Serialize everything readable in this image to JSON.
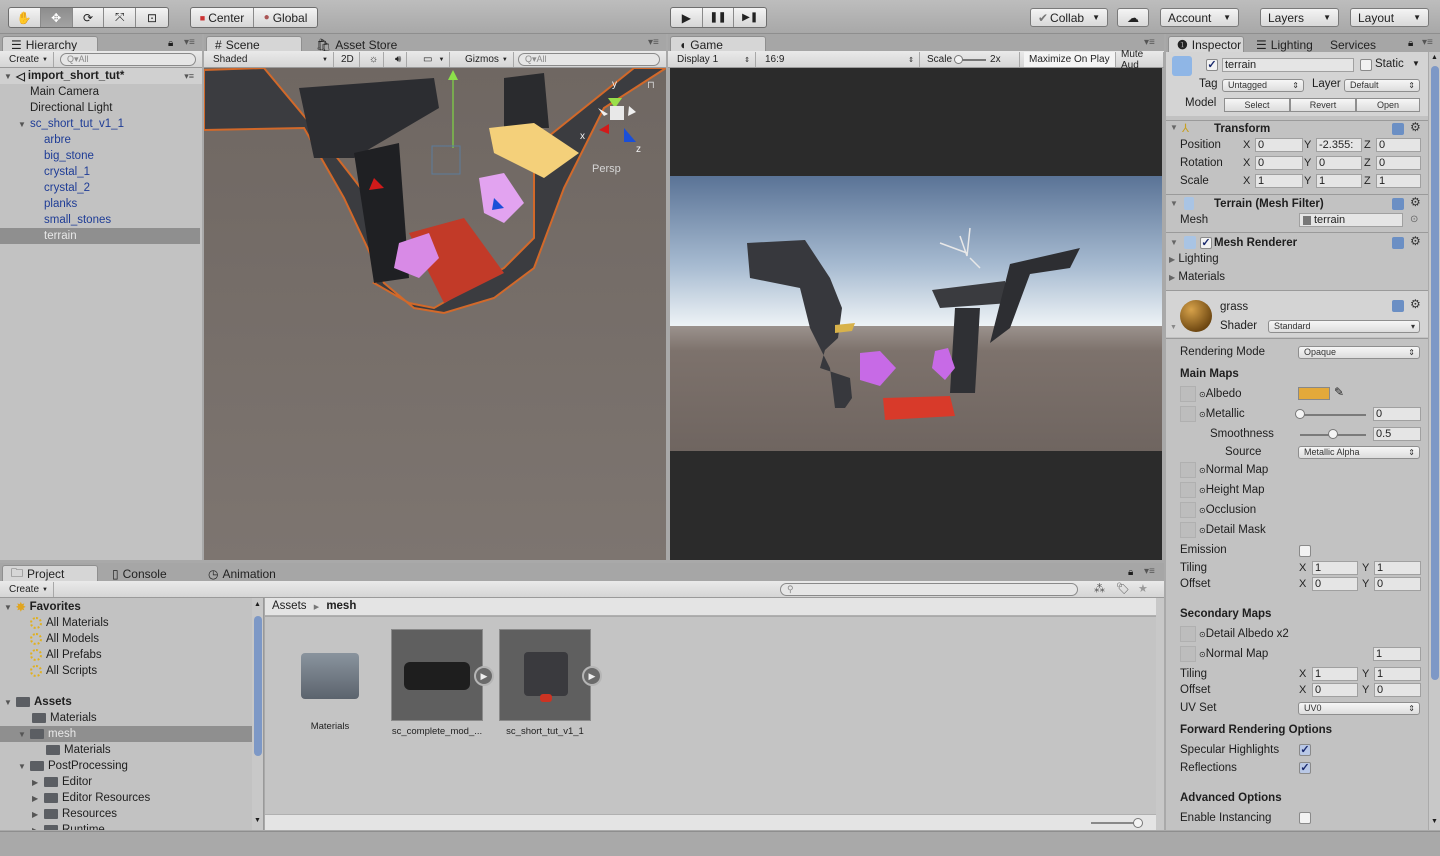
{
  "toolbar": {
    "transform_tools": [
      {
        "name": "hand-tool",
        "icon": "hand-icon",
        "glyph": "✋"
      },
      {
        "name": "move-tool",
        "icon": "move-icon",
        "glyph": "✥",
        "active": true
      },
      {
        "name": "rotate-tool",
        "icon": "rotate-icon",
        "glyph": "⟳"
      },
      {
        "name": "scale-tool",
        "icon": "scale-icon",
        "glyph": "⤧"
      },
      {
        "name": "rect-tool",
        "icon": "rect-icon",
        "glyph": "⊡"
      }
    ],
    "pivot_label": "Center",
    "space_label": "Global",
    "play": {
      "play_glyph": "▶",
      "pause_glyph": "❚❚",
      "step_glyph": "▶❚"
    },
    "collab_label": "Collab",
    "account_label": "Account",
    "layers_label": "Layers",
    "layout_label": "Layout"
  },
  "hierarchy": {
    "tab_label": "Hierarchy",
    "create_label": "Create",
    "search_placeholder": "Q▾All",
    "scene_name": "import_short_tut*",
    "items": [
      {
        "label": "Main Camera",
        "depth": 1,
        "prefab": false
      },
      {
        "label": "Directional Light",
        "depth": 1,
        "prefab": false
      },
      {
        "label": "sc_short_tut_v1_1",
        "depth": 1,
        "prefab": true,
        "expanded": true
      },
      {
        "label": "arbre",
        "depth": 2,
        "prefab": true
      },
      {
        "label": "big_stone",
        "depth": 2,
        "prefab": true
      },
      {
        "label": "crystal_1",
        "depth": 2,
        "prefab": true
      },
      {
        "label": "crystal_2",
        "depth": 2,
        "prefab": true
      },
      {
        "label": "planks",
        "depth": 2,
        "prefab": true
      },
      {
        "label": "small_stones",
        "depth": 2,
        "prefab": true
      },
      {
        "label": "terrain",
        "depth": 2,
        "prefab": true,
        "selected": true
      }
    ]
  },
  "scene": {
    "tab_label": "Scene",
    "asset_store_label": "Asset Store",
    "shading_mode": "Shaded",
    "mode_2d_label": "2D",
    "gizmos_label": "Gizmos",
    "search_placeholder": "Q▾All",
    "projection_label": "Persp",
    "axis_labels": {
      "x": "x",
      "y": "y",
      "z": "z"
    }
  },
  "game": {
    "tab_label": "Game",
    "display_label": "Display 1",
    "aspect_label": "16:9",
    "scale_label": "Scale",
    "scale_value": "2x",
    "maximize_label": "Maximize On Play",
    "mute_label": "Mute Aud"
  },
  "inspector": {
    "tabs": [
      "Inspector",
      "Lighting",
      "Services"
    ],
    "object_name": "terrain",
    "active": true,
    "static_label": "Static",
    "tag_label": "Tag",
    "tag_value": "Untagged",
    "layer_label": "Layer",
    "layer_value": "Default",
    "model_label": "Model",
    "model_buttons": [
      "Select",
      "Revert",
      "Open"
    ],
    "transform": {
      "title": "Transform",
      "rows": [
        {
          "label": "Position",
          "x": "0",
          "y": "-2.355:",
          "z": "0"
        },
        {
          "label": "Rotation",
          "x": "0",
          "y": "0",
          "z": "0"
        },
        {
          "label": "Scale",
          "x": "1",
          "y": "1",
          "z": "1"
        }
      ]
    },
    "mesh_filter": {
      "title": "Terrain (Mesh Filter)",
      "mesh_label": "Mesh",
      "mesh_value": "terrain"
    },
    "mesh_renderer": {
      "title": "Mesh Renderer",
      "enabled": true,
      "sections": [
        "Lighting",
        "Materials"
      ]
    },
    "material": {
      "name": "grass",
      "shader_label": "Shader",
      "shader_value": "Standard",
      "rendering_mode_label": "Rendering Mode",
      "rendering_mode_value": "Opaque",
      "main_maps_label": "Main Maps",
      "albedo_label": "Albedo",
      "albedo_color": "#e3a93a",
      "metallic_label": "Metallic",
      "metallic_value": "0",
      "metallic_fraction": 0.0,
      "smoothness_label": "Smoothness",
      "smoothness_value": "0.5",
      "smoothness_fraction": 0.5,
      "source_label": "Source",
      "source_value": "Metallic Alpha",
      "normal_map_label": "Normal Map",
      "height_map_label": "Height Map",
      "occlusion_label": "Occlusion",
      "detail_mask_label": "Detail Mask",
      "emission_label": "Emission",
      "emission_on": false,
      "tiling_label": "Tiling",
      "offset_label": "Offset",
      "main_tiling": {
        "x": "1",
        "y": "1"
      },
      "main_offset": {
        "x": "0",
        "y": "0"
      },
      "secondary_maps_label": "Secondary Maps",
      "detail_albedo_label": "Detail Albedo x2",
      "secondary_normal_label": "Normal Map",
      "secondary_normal_value": "1",
      "secondary_tiling": {
        "x": "1",
        "y": "1"
      },
      "secondary_offset": {
        "x": "0",
        "y": "0"
      },
      "uv_set_label": "UV Set",
      "uv_set_value": "UV0",
      "forward_label": "Forward Rendering Options",
      "specular_label": "Specular Highlights",
      "specular_on": true,
      "reflections_label": "Reflections",
      "reflections_on": true,
      "advanced_label": "Advanced Options",
      "instancing_label": "Enable Instancing",
      "instancing_on": false
    }
  },
  "project": {
    "tabs": [
      "Project",
      "Console",
      "Animation"
    ],
    "create_label": "Create",
    "favorites_label": "Favorites",
    "favorites": [
      "All Materials",
      "All Models",
      "All Prefabs",
      "All Scripts"
    ],
    "assets_label": "Assets",
    "tree": [
      {
        "label": "Materials",
        "depth": 1,
        "arrow": ""
      },
      {
        "label": "mesh",
        "depth": 1,
        "arrow": "▼",
        "selected": true
      },
      {
        "label": "Materials",
        "depth": 2,
        "arrow": ""
      },
      {
        "label": "PostProcessing",
        "depth": 1,
        "arrow": "▼"
      },
      {
        "label": "Editor",
        "depth": 2,
        "arrow": "▶"
      },
      {
        "label": "Editor Resources",
        "depth": 2,
        "arrow": "▶"
      },
      {
        "label": "Resources",
        "depth": 2,
        "arrow": "▶"
      },
      {
        "label": "Runtime",
        "depth": 2,
        "arrow": "▶"
      }
    ],
    "breadcrumb": [
      "Assets",
      "mesh"
    ],
    "assets": [
      {
        "label": "Materials",
        "kind": "folder"
      },
      {
        "label": "sc_complete_mod_...",
        "kind": "model"
      },
      {
        "label": "sc_short_tut_v1_1",
        "kind": "model"
      }
    ]
  }
}
